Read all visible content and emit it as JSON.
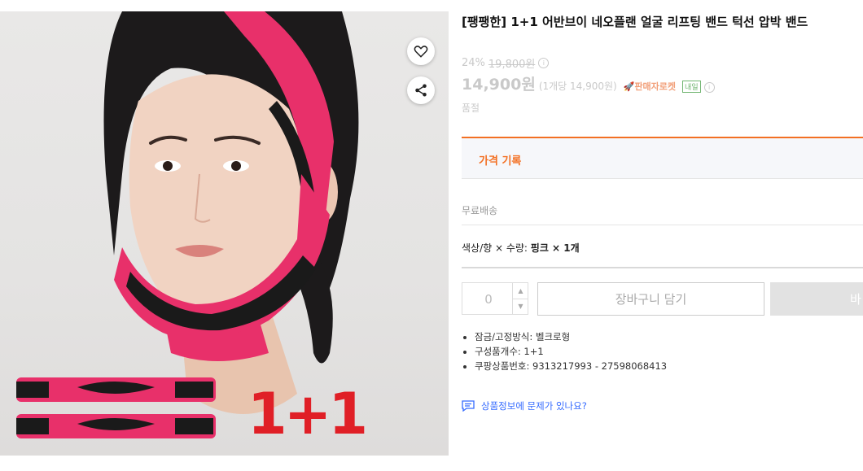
{
  "product": {
    "title": "[팽팽한] 1+1 어반브이 네오플랜 얼굴 리프팅 밴드 턱선 압박 밴드",
    "image_badge": "1+1"
  },
  "price": {
    "discount": "24%",
    "original": "19,800원",
    "current": "14,900원",
    "unit_price": "(1개당 14,900원)",
    "rocket_label": "판매자로켓",
    "tomorrow_badge": "내일",
    "soldout": "품절"
  },
  "history": {
    "label": "가격 기록"
  },
  "shipping": {
    "label": "무료배송"
  },
  "option": {
    "prefix": "색상/향 × 수량: ",
    "value": "핑크 × 1개"
  },
  "purchase": {
    "quantity": "0",
    "cart_label": "장바구니 담기",
    "buy_label": "바"
  },
  "specs": [
    "잠금/고정방식: 벨크로형",
    "구성품개수: 1+1",
    "쿠팡상품번호: 9313217993 - 27598068413"
  ],
  "report": {
    "label": "상품정보에 문제가 있나요?"
  },
  "colors": {
    "accent": "#f37023",
    "link": "#346aff",
    "band_pink": "#e8306a",
    "badge_red": "#e01f26"
  }
}
